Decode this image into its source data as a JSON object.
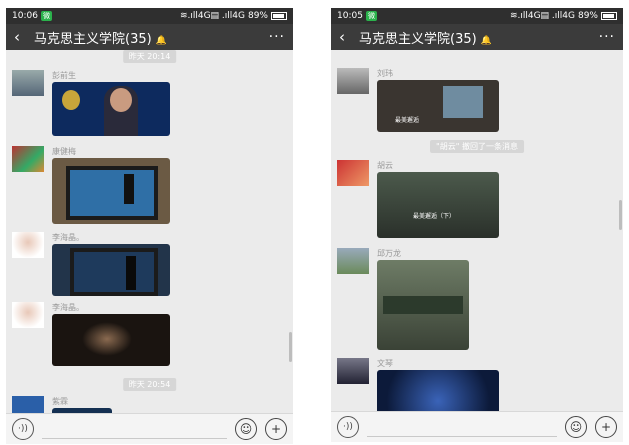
{
  "left": {
    "status": {
      "time": "10:06",
      "badge": "微",
      "signal": "≋.ıll4G▤ .ıll4G",
      "battery": "89%"
    },
    "title": "马克思主义学院(35)",
    "more": "···",
    "time_top": "昨天 20:14",
    "time_bottom": "昨天 20:54",
    "messages": [
      {
        "sender": "彭前生"
      },
      {
        "sender": "康健梅"
      },
      {
        "sender": "李海晶。"
      },
      {
        "sender": "李海晶。"
      },
      {
        "sender": "紫霖"
      }
    ]
  },
  "right": {
    "status": {
      "time": "10:05",
      "badge": "微",
      "signal": "≋.ıll4G▤ .ıll4G",
      "battery": "89%"
    },
    "title": "马克思主义学院(35)",
    "more": "···",
    "recall_notice": "\"胡云\" 撤回了一条消息",
    "messages": [
      {
        "sender": "刘玮",
        "caption": "最美邂逅"
      },
      {
        "sender": "胡云",
        "caption": "最美邂逅（下）"
      },
      {
        "sender": "邱万龙"
      },
      {
        "sender": "文琴"
      }
    ]
  },
  "icons": {
    "back": "‹",
    "voice": "·))",
    "emoji": "☺",
    "plus": "+"
  }
}
